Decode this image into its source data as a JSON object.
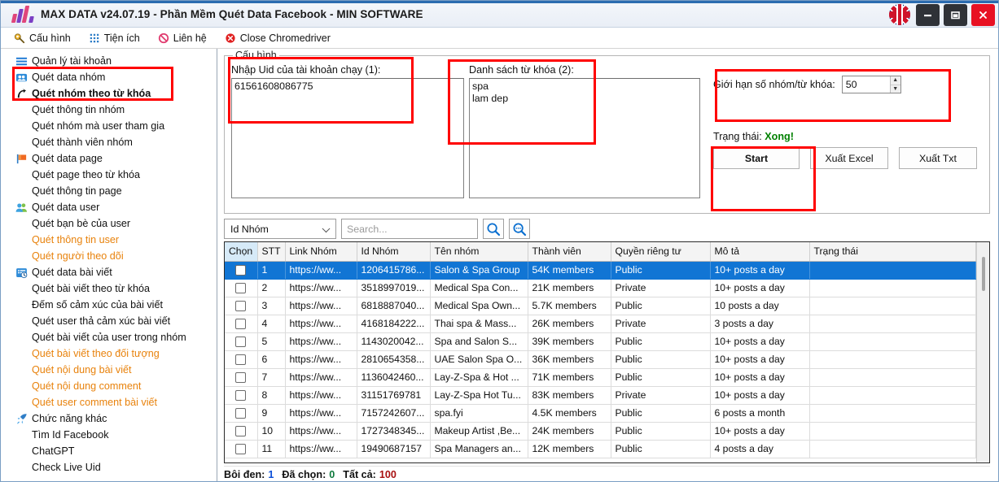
{
  "titlebar": {
    "app_title": "MAX DATA v24.07.19 - Phần Mềm Quét Data Facebook - MIN SOFTWARE",
    "flag_icon": "uk-flag-icon",
    "minimize_icon": "minimize-icon",
    "maximize_icon": "maximize-icon",
    "close_icon": "close-icon",
    "accent": "#2b6cb0",
    "close_color": "#e81123"
  },
  "menubar": {
    "items": [
      {
        "label": "Cấu hình",
        "icon": "wrench-icon"
      },
      {
        "label": "Tiện ích",
        "icon": "grid-dots-icon"
      },
      {
        "label": "Liên hệ",
        "icon": "no-entry-icon"
      },
      {
        "label": "Close Chromedriver",
        "icon": "close-circle-icon"
      }
    ]
  },
  "sidebar": {
    "items": [
      {
        "label": "Quản lý tài khoản",
        "icon": "hamburger-icon",
        "level": 0,
        "color": "black",
        "bold": false
      },
      {
        "label": "Quét data nhóm",
        "icon": "group-icon",
        "level": 0,
        "color": "black",
        "bold": false
      },
      {
        "label": "Quét nhóm theo từ khóa",
        "icon": "cursor-icon",
        "level": 0,
        "color": "black",
        "bold": true
      },
      {
        "label": "Quét thông tin nhóm",
        "icon": "",
        "level": 1,
        "color": "black",
        "bold": false
      },
      {
        "label": "Quét nhóm mà user tham gia",
        "icon": "",
        "level": 1,
        "color": "black",
        "bold": false
      },
      {
        "label": "Quét thành viên nhóm",
        "icon": "",
        "level": 1,
        "color": "black",
        "bold": false
      },
      {
        "label": "Quét data page",
        "icon": "flag-icon",
        "level": 0,
        "color": "black",
        "bold": false
      },
      {
        "label": "Quét page theo từ khóa",
        "icon": "",
        "level": 1,
        "color": "black",
        "bold": false
      },
      {
        "label": "Quét thông tin page",
        "icon": "",
        "level": 1,
        "color": "black",
        "bold": false
      },
      {
        "label": "Quét data user",
        "icon": "users-icon",
        "level": 0,
        "color": "black",
        "bold": false
      },
      {
        "label": "Quét bạn bè của user",
        "icon": "",
        "level": 1,
        "color": "black",
        "bold": false
      },
      {
        "label": "Quét thông tin user",
        "icon": "",
        "level": 1,
        "color": "orange",
        "bold": false
      },
      {
        "label": "Quét người theo dõi",
        "icon": "",
        "level": 1,
        "color": "orange",
        "bold": false
      },
      {
        "label": "Quét data bài viết",
        "icon": "post-clock-icon",
        "level": 0,
        "color": "black",
        "bold": false
      },
      {
        "label": "Quét bài viết theo từ khóa",
        "icon": "",
        "level": 1,
        "color": "black",
        "bold": false
      },
      {
        "label": "Đếm số cảm xúc của bài viết",
        "icon": "",
        "level": 1,
        "color": "black",
        "bold": false
      },
      {
        "label": "Quét user thả cảm xúc bài viết",
        "icon": "",
        "level": 1,
        "color": "black",
        "bold": false
      },
      {
        "label": "Quét bài viết của user trong nhóm",
        "icon": "",
        "level": 1,
        "color": "black",
        "bold": false
      },
      {
        "label": "Quét bài viết theo đối tượng",
        "icon": "",
        "level": 1,
        "color": "orange",
        "bold": false
      },
      {
        "label": "Quét nội dung bài viết",
        "icon": "",
        "level": 1,
        "color": "orange",
        "bold": false
      },
      {
        "label": "Quét nội dung comment",
        "icon": "",
        "level": 1,
        "color": "orange",
        "bold": false
      },
      {
        "label": "Quét user comment bài viết",
        "icon": "",
        "level": 1,
        "color": "orange",
        "bold": false
      },
      {
        "label": "Chức năng khác",
        "icon": "rocket-icon",
        "level": 0,
        "color": "black",
        "bold": false
      },
      {
        "label": "Tìm Id Facebook",
        "icon": "",
        "level": 1,
        "color": "black",
        "bold": false
      },
      {
        "label": "ChatGPT",
        "icon": "",
        "level": 1,
        "color": "black",
        "bold": false
      },
      {
        "label": "Check Live Uid",
        "icon": "",
        "level": 1,
        "color": "black",
        "bold": false
      }
    ]
  },
  "config": {
    "legend": "Cấu hình",
    "uid_label": "Nhập Uid của tài khoản chạy (1):",
    "uid_value": "61561608086775",
    "keyword_label": "Danh sách từ khóa (2):",
    "keyword_value": "spa\nlam dep",
    "limit_label": "Giới hạn số nhóm/từ khóa:",
    "limit_value": "50",
    "status_label": "Trạng thái:",
    "status_value": "Xong!",
    "status_color": "#008000",
    "start_label": "Start",
    "export_excel_label": "Xuất Excel",
    "export_txt_label": "Xuất Txt"
  },
  "search": {
    "field_selected": "Id Nhóm",
    "placeholder": "Search...",
    "search_icon": "magnifier-icon",
    "advanced_search_icon": "magnifier-more-icon"
  },
  "table": {
    "columns": [
      "Chọn",
      "STT",
      "Link Nhóm",
      "Id Nhóm",
      "Tên nhóm",
      "Thành viên",
      "Quyền riêng tư",
      "Mô tả",
      "Trạng thái"
    ],
    "rows": [
      {
        "stt": "1",
        "link": "https://ww...",
        "id": "1206415786...",
        "name": "Salon & Spa Group",
        "members": "54K members",
        "privacy": "Public",
        "desc": "10+ posts a day",
        "status": "",
        "selected": true
      },
      {
        "stt": "2",
        "link": "https://ww...",
        "id": "3518997019...",
        "name": "Medical Spa Con...",
        "members": "21K members",
        "privacy": "Private",
        "desc": "10+ posts a day",
        "status": "",
        "selected": false
      },
      {
        "stt": "3",
        "link": "https://ww...",
        "id": "6818887040...",
        "name": "Medical Spa Own...",
        "members": "5.7K members",
        "privacy": "Public",
        "desc": "10 posts a day",
        "status": "",
        "selected": false
      },
      {
        "stt": "4",
        "link": "https://ww...",
        "id": "4168184222...",
        "name": "Thai spa & Mass...",
        "members": "26K members",
        "privacy": "Private",
        "desc": "3 posts a day",
        "status": "",
        "selected": false
      },
      {
        "stt": "5",
        "link": "https://ww...",
        "id": "1143020042...",
        "name": "Spa and Salon S...",
        "members": "39K members",
        "privacy": "Public",
        "desc": "10+ posts a day",
        "status": "",
        "selected": false
      },
      {
        "stt": "6",
        "link": "https://ww...",
        "id": "2810654358...",
        "name": "UAE Salon Spa O...",
        "members": "36K members",
        "privacy": "Public",
        "desc": "10+ posts a day",
        "status": "",
        "selected": false
      },
      {
        "stt": "7",
        "link": "https://ww...",
        "id": "1136042460...",
        "name": "Lay-Z-Spa & Hot ...",
        "members": "71K members",
        "privacy": "Public",
        "desc": "10+ posts a day",
        "status": "",
        "selected": false
      },
      {
        "stt": "8",
        "link": "https://ww...",
        "id": "31151769781",
        "name": "Lay-Z-Spa Hot Tu...",
        "members": "83K members",
        "privacy": "Private",
        "desc": "10+ posts a day",
        "status": "",
        "selected": false
      },
      {
        "stt": "9",
        "link": "https://ww...",
        "id": "7157242607...",
        "name": "spa.fyi",
        "members": "4.5K members",
        "privacy": "Public",
        "desc": "6 posts a month",
        "status": "",
        "selected": false
      },
      {
        "stt": "10",
        "link": "https://ww...",
        "id": "1727348345...",
        "name": "Makeup Artist ,Be...",
        "members": "24K members",
        "privacy": "Public",
        "desc": "10+ posts a day",
        "status": "",
        "selected": false
      },
      {
        "stt": "11",
        "link": "https://ww...",
        "id": "19490687157",
        "name": "Spa Managers an...",
        "members": "12K members",
        "privacy": "Public",
        "desc": "4 posts a day",
        "status": "",
        "selected": false
      }
    ]
  },
  "footer": {
    "highlight_label": "Bôi đen:",
    "highlight_value": "1",
    "selected_label": "Đã chọn:",
    "selected_value": "0",
    "total_label": "Tất cả:",
    "total_value": "100"
  }
}
